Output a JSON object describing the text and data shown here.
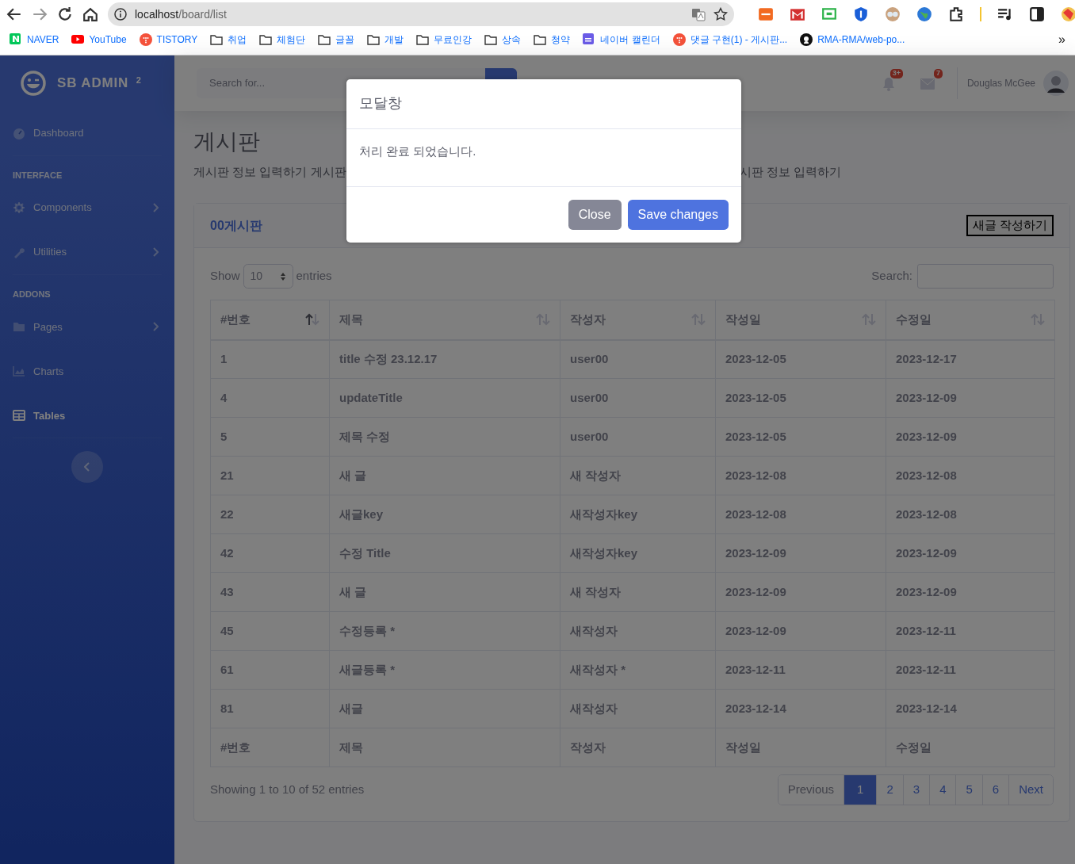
{
  "browser": {
    "url_host": "localhost",
    "url_path": "/board/list",
    "bookmarks": [
      {
        "label": "NAVER",
        "kind": "naver"
      },
      {
        "label": "YouTube",
        "kind": "youtube"
      },
      {
        "label": "TISTORY",
        "kind": "tistory"
      },
      {
        "label": "취업",
        "kind": "folder"
      },
      {
        "label": "체험단",
        "kind": "folder"
      },
      {
        "label": "글꼴",
        "kind": "folder"
      },
      {
        "label": "개발",
        "kind": "folder"
      },
      {
        "label": "무료인강",
        "kind": "folder"
      },
      {
        "label": "상속",
        "kind": "folder"
      },
      {
        "label": "청약",
        "kind": "folder"
      },
      {
        "label": "네이버 캘린더",
        "kind": "calendar"
      },
      {
        "label": "댓글 구현(1) - 게시판...",
        "kind": "tistory"
      },
      {
        "label": "RMA-RMA/web-po...",
        "kind": "github"
      }
    ],
    "overflow": "»"
  },
  "sidebar": {
    "brand": "SB ADMIN",
    "brand_sup": "2",
    "items": [
      {
        "kind": "link",
        "label": "Dashboard",
        "has_submenu": false,
        "selected": false
      },
      {
        "kind": "divider"
      },
      {
        "kind": "heading",
        "label": "INTERFACE"
      },
      {
        "kind": "link",
        "label": "Components",
        "has_submenu": true,
        "selected": false
      },
      {
        "kind": "link",
        "label": "Utilities",
        "has_submenu": true,
        "selected": false
      },
      {
        "kind": "divider"
      },
      {
        "kind": "heading",
        "label": "ADDONS"
      },
      {
        "kind": "link",
        "label": "Pages",
        "has_submenu": true,
        "selected": false
      },
      {
        "kind": "link",
        "label": "Charts",
        "has_submenu": false,
        "selected": false
      },
      {
        "kind": "link",
        "label": "Tables",
        "has_submenu": false,
        "selected": true
      },
      {
        "kind": "divider"
      }
    ]
  },
  "topbar": {
    "search_placeholder": "Search for...",
    "alerts_badge": "3+",
    "messages_badge": "7",
    "user_name": "Douglas McGee"
  },
  "page": {
    "title": "게시판",
    "subtitle_parts": [
      "게시판 정보 입력하기 게시판",
      "시판 정보 입력하기"
    ]
  },
  "card": {
    "title": "00게시판",
    "new_button": "새글 작성하기",
    "show_label": "Show",
    "length_value": "10",
    "entries_label": "entries",
    "search_label": "Search:",
    "columns": [
      {
        "label": "#번호",
        "sorted_ascending": true
      },
      {
        "label": "제목",
        "sorted_ascending": false
      },
      {
        "label": "작성자",
        "sorted_ascending": false
      },
      {
        "label": "작성일",
        "sorted_ascending": false
      },
      {
        "label": "수정일",
        "sorted_ascending": false
      }
    ],
    "rows": [
      [
        "1",
        "title 수정 23.12.17",
        "user00",
        "2023-12-05",
        "2023-12-17"
      ],
      [
        "4",
        "updateTitle",
        "user00",
        "2023-12-05",
        "2023-12-09"
      ],
      [
        "5",
        "제목 수정",
        "user00",
        "2023-12-05",
        "2023-12-09"
      ],
      [
        "21",
        "새 글",
        "새 작성자",
        "2023-12-08",
        "2023-12-08"
      ],
      [
        "22",
        "새글key",
        "새작성자key",
        "2023-12-08",
        "2023-12-08"
      ],
      [
        "42",
        "수정 Title",
        "새작성자key",
        "2023-12-09",
        "2023-12-09"
      ],
      [
        "43",
        "새 글",
        "새 작성자",
        "2023-12-09",
        "2023-12-09"
      ],
      [
        "45",
        "수정등록 *",
        "새작성자",
        "2023-12-09",
        "2023-12-11"
      ],
      [
        "61",
        "새글등록 *",
        "새작성자 *",
        "2023-12-11",
        "2023-12-11"
      ],
      [
        "81",
        "새글",
        "새작성자",
        "2023-12-14",
        "2023-12-14"
      ]
    ],
    "footer_columns": [
      "#번호",
      "제목",
      "작성자",
      "작성일",
      "수정일"
    ],
    "info": "Showing 1 to 10 of 52 entries",
    "pagination": [
      {
        "label": "Previous",
        "disabled": true,
        "selected": false
      },
      {
        "label": "1",
        "disabled": false,
        "selected": true
      },
      {
        "label": "2",
        "disabled": false,
        "selected": false
      },
      {
        "label": "3",
        "disabled": false,
        "selected": false
      },
      {
        "label": "4",
        "disabled": false,
        "selected": false
      },
      {
        "label": "5",
        "disabled": false,
        "selected": false
      },
      {
        "label": "6",
        "disabled": false,
        "selected": false
      },
      {
        "label": "Next",
        "disabled": false,
        "selected": false
      }
    ]
  },
  "modal": {
    "title": "모달창",
    "body": "처리 완료 되었습니다.",
    "buttons": [
      {
        "label": "Close",
        "kind": "secondary"
      },
      {
        "label": "Save changes",
        "kind": "primary"
      }
    ]
  }
}
